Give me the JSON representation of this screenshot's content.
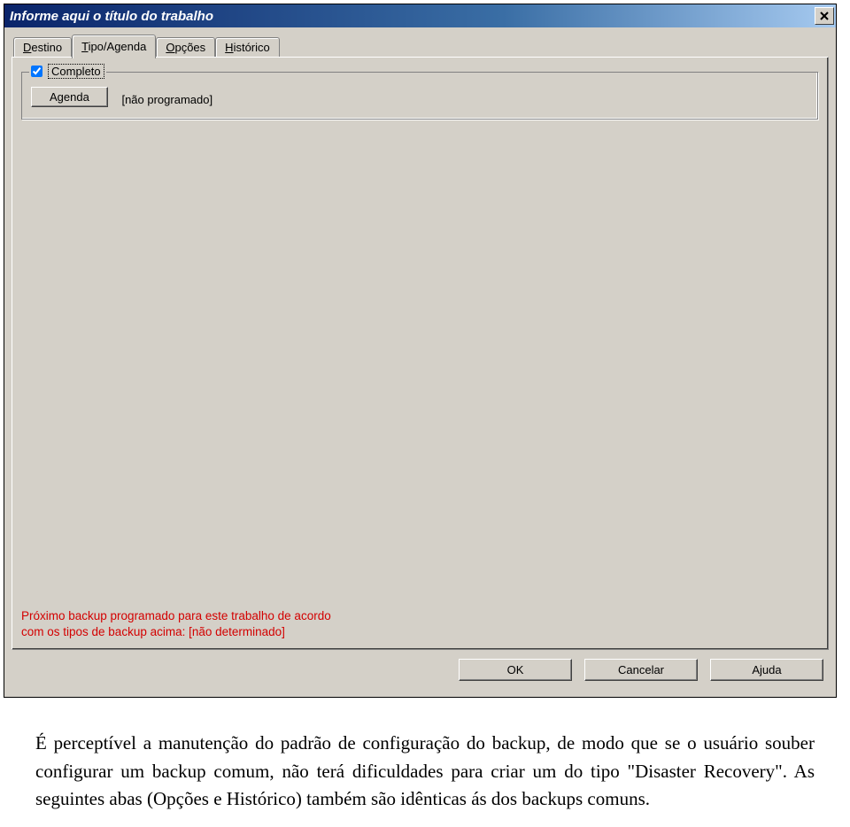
{
  "window": {
    "title": "Informe aqui o título do trabalho",
    "close": "✕"
  },
  "tabs": {
    "destino": "Destino",
    "tipo": "Tipo/Agenda",
    "opcoes": "Opções",
    "historico": "Histórico"
  },
  "group": {
    "checkbox_label": "Completo",
    "agenda_btn": "Agenda",
    "status": "[não programado]"
  },
  "red": {
    "line1": "Próximo backup programado para este trabalho de acordo",
    "line2": "com os tipos de backup acima: [não determinado]"
  },
  "buttons": {
    "ok": "OK",
    "cancel": "Cancelar",
    "help": "Ajuda"
  },
  "doc": {
    "p1_a": "É perceptível a manutenção do padrão de configuração do backup, de modo que se o usuário souber configurar um backup comum, não terá dificuldades para criar um do tipo \"Disaster Recovery\". As seguintes abas (Opções e Histórico) também são idênticas ás dos backups comuns."
  }
}
